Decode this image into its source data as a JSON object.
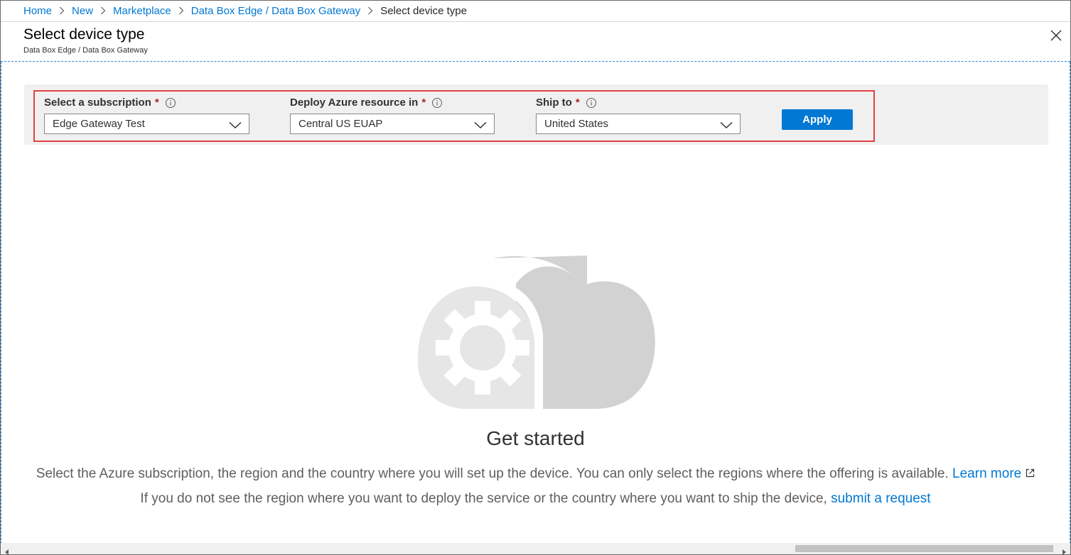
{
  "breadcrumb": {
    "items": [
      "Home",
      "New",
      "Marketplace",
      "Data Box Edge / Data Box Gateway"
    ],
    "current": "Select device type"
  },
  "header": {
    "title": "Select device type",
    "subtitle": "Data Box Edge / Data Box Gateway",
    "close_icon": "close-icon"
  },
  "filters": {
    "subscription": {
      "label": "Select a subscription",
      "required": "*",
      "value": "Edge Gateway Test"
    },
    "region": {
      "label": "Deploy Azure resource in",
      "required": "*",
      "value": "Central US EUAP"
    },
    "ship_to": {
      "label": "Ship to",
      "required": "*",
      "value": "United States"
    },
    "apply_label": "Apply"
  },
  "empty_state": {
    "illustration_icon": "cloud-gear-icon",
    "title": "Get started",
    "line1": "Select the Azure subscription, the region and the country where you will set up the device. You can only select the regions where the offering is available.",
    "learn_more": "Learn more",
    "line2": "If you do not see the region where you want to deploy the service or the country where you want to ship the device,",
    "submit_request": "submit a request"
  },
  "colors": {
    "accent": "#0078d4",
    "highlight": "#e04245",
    "required": "#a4262c",
    "panel": "#f0f0f0"
  }
}
